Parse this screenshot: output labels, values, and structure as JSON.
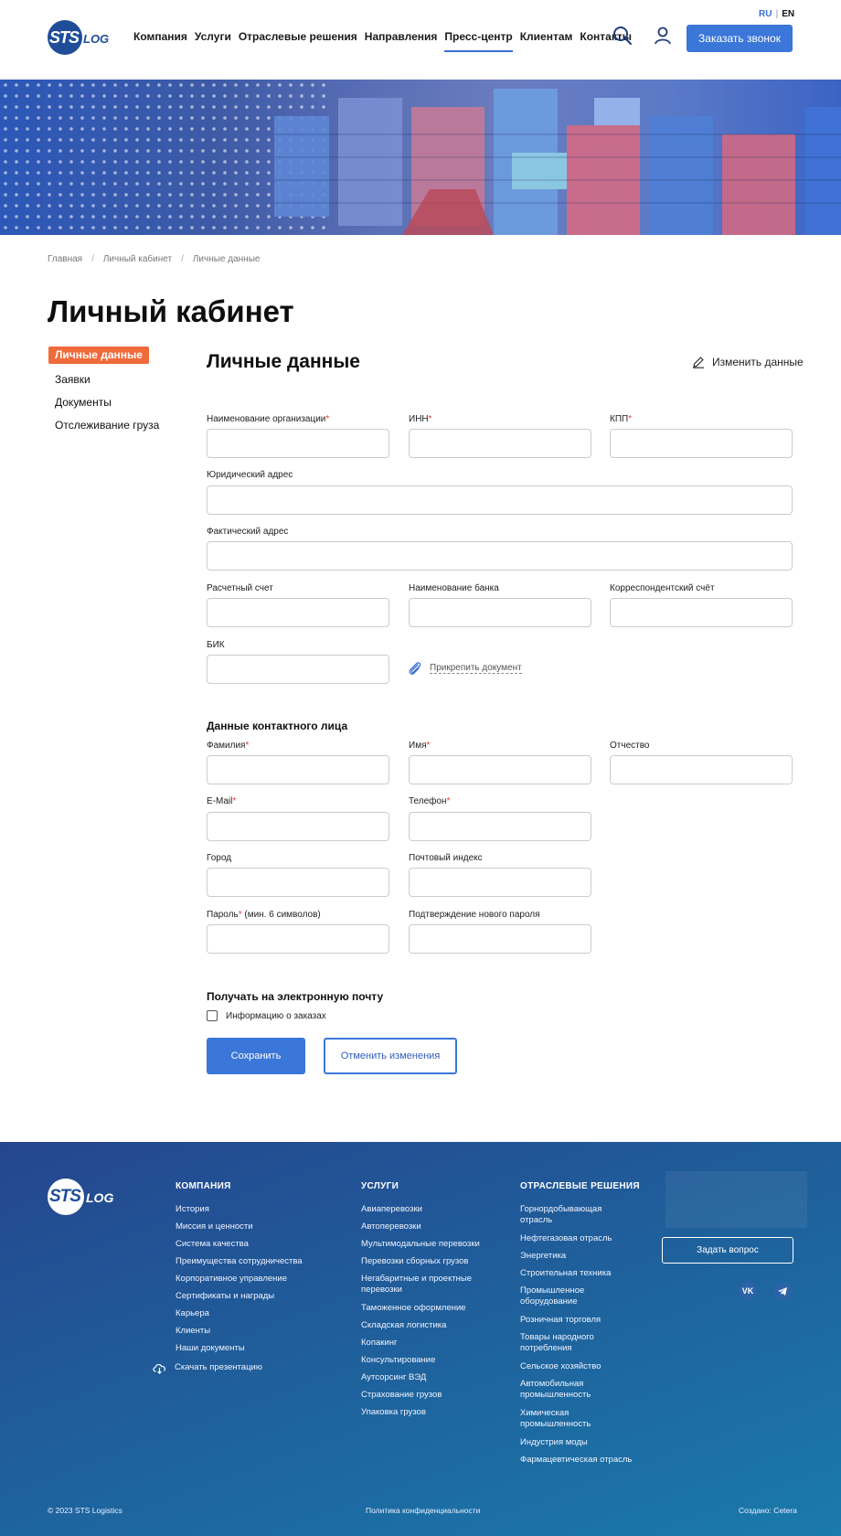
{
  "header": {
    "logo_sts": "STS",
    "logo_log": "LOG",
    "nav": [
      "Компания",
      "Услуги",
      "Отраслевые решения",
      "Направления",
      "Пресс-центр",
      "Клиентам",
      "Контакты"
    ],
    "lang_ru": "RU",
    "lang_sep": "|",
    "lang_en": "EN",
    "call_button": "Заказать звонок",
    "search_icon": "search-icon",
    "user_icon": "user-icon"
  },
  "breadcrumb": [
    "Главная",
    "Личный кабинет",
    "Личные данные"
  ],
  "breadcrumb_sep": "/",
  "page_title": "Личный кабинет",
  "sidebar": {
    "items": [
      "Личные данные",
      "Заявки",
      "Документы",
      "Отслеживание груза"
    ],
    "active_color": "#f06a3a"
  },
  "section": {
    "title": "Личные данные",
    "edit_link": "Изменить данные"
  },
  "org_fields": {
    "org_name": "Наименование организации",
    "inn": "ИНН",
    "kpp": "КПП",
    "legal_address": "Юридический адрес",
    "actual_address": "Фактический адрес",
    "account": "Расчетный счет",
    "bank_name": "Наименование банка",
    "corr_account": "Корреспондентский счёт",
    "bik": "БИК",
    "attach": "Прикрепить документ"
  },
  "contact": {
    "title": "Данные контактного лица",
    "surname": "Фамилия",
    "name": "Имя",
    "patronymic": "Отчество",
    "email": "E-Mail",
    "phone": "Телефон",
    "city": "Город",
    "postcode": "Почтовый индекс",
    "password": "Пароль",
    "password_hint": " (мин. 6 символов)",
    "password_confirm": "Подтверждение нового пароля"
  },
  "required_mark": "*",
  "subscribe": {
    "title": "Получать на электронную почту",
    "option": "Информацию о заказах",
    "checked": false
  },
  "buttons": {
    "save": "Сохранить",
    "cancel": "Отменить изменения"
  },
  "footer": {
    "company_title": "КОМПАНИЯ",
    "company_links": [
      "История",
      "Миссия и ценности",
      "Система качества",
      "Преимущества сотрудничества",
      "Корпоративное управление",
      "Сертификаты и награды",
      "Карьера",
      "Клиенты",
      "Наши документы"
    ],
    "download": "Скачать презентацию",
    "services_title": "УСЛУГИ",
    "services_links": [
      "Авиаперевозки",
      "Автоперевозки",
      "Мультимодальные перевозки",
      "Перевозки сборных грузов",
      "Негабаритные и проектные перевозки",
      "Таможенное оформление",
      "Складская логистика",
      "Копакинг",
      "Консультирование",
      "Аутсорсинг ВЭД",
      "Страхование грузов",
      "Упаковка грузов"
    ],
    "industry_title": "ОТРАСЛЕВЫЕ РЕШЕНИЯ",
    "industry_links": [
      "Горнордобывающая отрасль",
      "Нефтегазовая отрасль",
      "Энергетика",
      "Строительная техника",
      "Промышленное оборудование",
      "Розничная торговля",
      "Товары народного потребления",
      "Сельское хозяйство",
      "Автомобильная промышленность",
      "Химическая промышленность",
      "Индустрия моды",
      "Фармацевтическая отрасль"
    ],
    "ask_button": "Задать вопрос",
    "social": [
      "VK",
      "TG"
    ],
    "copyright": "© 2023 STS Logistics",
    "privacy": "Политика конфиденциальности",
    "created": "Создано: Cetera"
  }
}
